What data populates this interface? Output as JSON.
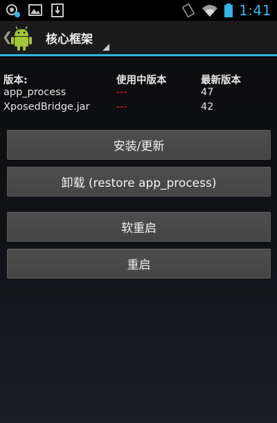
{
  "status_bar": {
    "time": "1:41",
    "icons": [
      "xposed-notification-icon",
      "image-notification-icon",
      "download-notification-icon",
      "rotation-icon",
      "wifi-icon",
      "battery-icon"
    ],
    "time_color": "#33b5e5"
  },
  "action_bar": {
    "title": "核心框架",
    "icon": "android-icon",
    "accent_color": "#33b5e5"
  },
  "versions": {
    "headers": [
      "版本:",
      "使用中版本",
      "最新版本"
    ],
    "rows": [
      {
        "name": "app_process",
        "installed": "---",
        "latest": "47"
      },
      {
        "name": "XposedBridge.jar",
        "installed": "---",
        "latest": "42"
      }
    ],
    "missing_color": "#ff2020"
  },
  "buttons": {
    "install": "安装/更新",
    "uninstall": "卸载 (restore app_process)",
    "soft_reboot": "软重启",
    "reboot": "重启"
  }
}
